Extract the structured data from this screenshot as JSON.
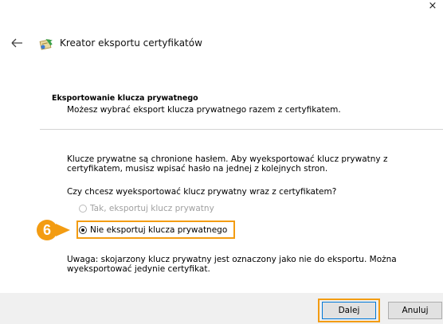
{
  "window": {
    "close_glyph": "×"
  },
  "header": {
    "title": "Kreator eksportu certyfikatów",
    "back_icon": "back-arrow-icon",
    "wizard_icon": "certificate-wizard-icon"
  },
  "section": {
    "title": "Eksportowanie klucza prywatnego",
    "description": "Możesz wybrać eksport klucza prywatnego razem z certyfikatem."
  },
  "body": {
    "info": "Klucze prywatne są chronione hasłem. Aby wyeksportować klucz prywatny z certyfikatem, musisz wpisać hasło na jednej z kolejnych stron.",
    "question": "Czy chcesz wyeksportować klucz prywatny wraz z certyfikatem?",
    "options": [
      {
        "label": "Tak, eksportuj klucz prywatny",
        "enabled": false,
        "selected": false
      },
      {
        "label": "Nie eksportuj klucza prywatnego",
        "enabled": true,
        "selected": true
      }
    ],
    "note": "Uwaga: skojarzony klucz prywatny jest oznaczony jako nie do eksportu. Można wyeksportować jedynie certyfikat."
  },
  "annotation": {
    "step_number": "6",
    "color": "#f39c12"
  },
  "footer": {
    "next_label": "Dalej",
    "cancel_label": "Anuluj"
  }
}
